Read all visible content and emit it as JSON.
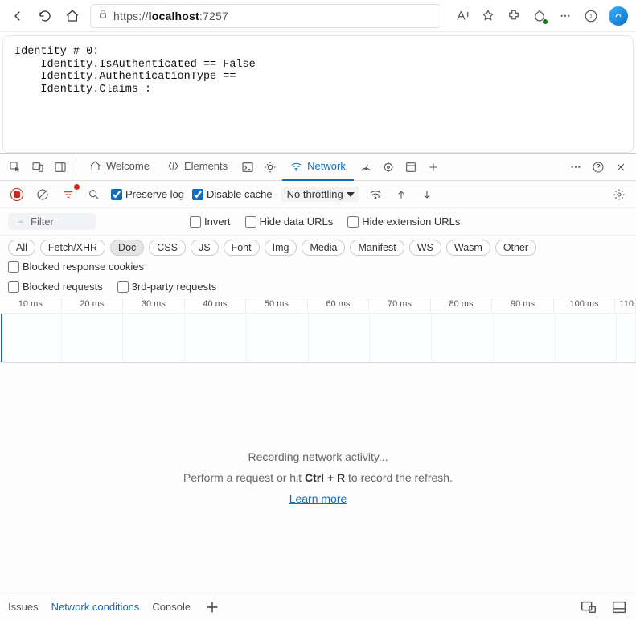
{
  "browser": {
    "url_prefix": "https://",
    "url_host": "localhost",
    "url_port": ":7257"
  },
  "page": {
    "line1": "Identity # 0:",
    "line2": "    Identity.IsAuthenticated == False",
    "line3": "    Identity.AuthenticationType ==",
    "line4": "    Identity.Claims :"
  },
  "devtools": {
    "tabs": {
      "welcome": "Welcome",
      "elements": "Elements",
      "network": "Network"
    },
    "net_toolbar": {
      "preserve_log": "Preserve log",
      "disable_cache": "Disable cache",
      "throttling": "No throttling"
    },
    "filter_row": {
      "filter_placeholder": "Filter",
      "invert": "Invert",
      "hide_data_urls": "Hide data URLs",
      "hide_ext_urls": "Hide extension URLs"
    },
    "types": [
      "All",
      "Fetch/XHR",
      "Doc",
      "CSS",
      "JS",
      "Font",
      "Img",
      "Media",
      "Manifest",
      "WS",
      "Wasm",
      "Other"
    ],
    "active_type": "Doc",
    "blocked_cookies": "Blocked response cookies",
    "blocked_requests": "Blocked requests",
    "third_party": "3rd-party requests",
    "timeline_ticks": [
      "10 ms",
      "20 ms",
      "30 ms",
      "40 ms",
      "50 ms",
      "60 ms",
      "70 ms",
      "80 ms",
      "90 ms",
      "100 ms",
      "110"
    ],
    "empty": {
      "l1": "Recording network activity...",
      "l2a": "Perform a request or hit ",
      "l2b": "Ctrl + R",
      "l2c": " to record the refresh.",
      "learn_more": "Learn more"
    }
  },
  "bottom": {
    "issues": "Issues",
    "network_conditions": "Network conditions",
    "console": "Console"
  }
}
